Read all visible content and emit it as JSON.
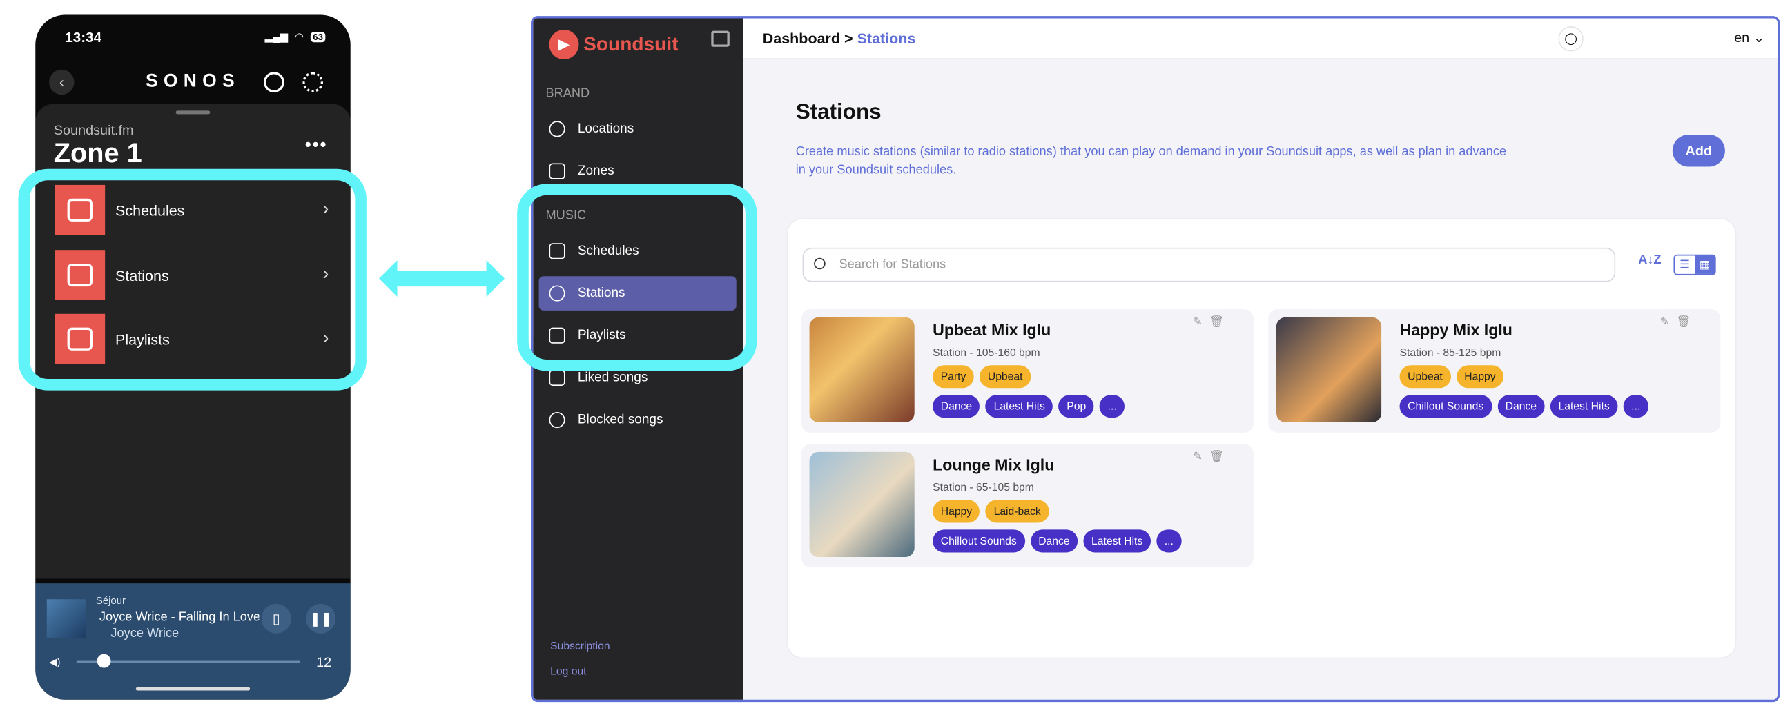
{
  "phone": {
    "time": "13:34",
    "battery": "63",
    "brand": "SONOS",
    "service": "Soundsuit.fm",
    "zone": "Zone 1",
    "more": "•••",
    "menu": [
      {
        "label": "Schedules"
      },
      {
        "label": "Stations"
      },
      {
        "label": "Playlists"
      }
    ],
    "player": {
      "room": "Séjour",
      "track": "Joyce Wrice - Falling In Love",
      "artist": "Joyce Wrice",
      "volume": "12",
      "volume_level": 0.12
    }
  },
  "dashboard": {
    "brand": "Soundsuit",
    "sections": {
      "brand": "BRAND",
      "music": "MUSIC"
    },
    "brand_items": [
      {
        "label": "Locations"
      },
      {
        "label": "Zones"
      }
    ],
    "music_items": [
      {
        "label": "Schedules"
      },
      {
        "label": "Stations"
      },
      {
        "label": "Playlists"
      },
      {
        "label": "Liked songs"
      },
      {
        "label": "Blocked songs"
      }
    ],
    "footer": {
      "subscription": "Subscription",
      "logout": "Log out"
    },
    "breadcrumb": {
      "root": "Dashboard",
      "sep": ">",
      "current": "Stations"
    },
    "lang": "en",
    "title": "Stations",
    "description": "Create music stations (similar to radio stations) that you can play on demand in your Soundsuit apps, as well as plan in advance in your Soundsuit schedules.",
    "add_label": "Add",
    "search_placeholder": "Search for Stations",
    "stations": [
      {
        "name": "Upbeat Mix Iglu",
        "bpm": "Station - 105-160 bpm",
        "moods": [
          "Party",
          "Upbeat"
        ],
        "genres": [
          "Dance",
          "Latest Hits",
          "Pop",
          "..."
        ]
      },
      {
        "name": "Happy Mix Iglu",
        "bpm": "Station - 85-125 bpm",
        "moods": [
          "Upbeat",
          "Happy"
        ],
        "genres": [
          "Chillout Sounds",
          "Dance",
          "Latest Hits",
          "..."
        ]
      },
      {
        "name": "Lounge Mix Iglu",
        "bpm": "Station - 65-105 bpm",
        "moods": [
          "Happy",
          "Laid-back"
        ],
        "genres": [
          "Chillout Sounds",
          "Dance",
          "Latest Hits",
          "..."
        ]
      }
    ]
  },
  "colors": {
    "highlight": "#60f3f8",
    "accent": "#5f6fd7",
    "brand": "#e8574f",
    "tag_mood": "#f5b42c",
    "tag_genre": "#4630c6"
  }
}
